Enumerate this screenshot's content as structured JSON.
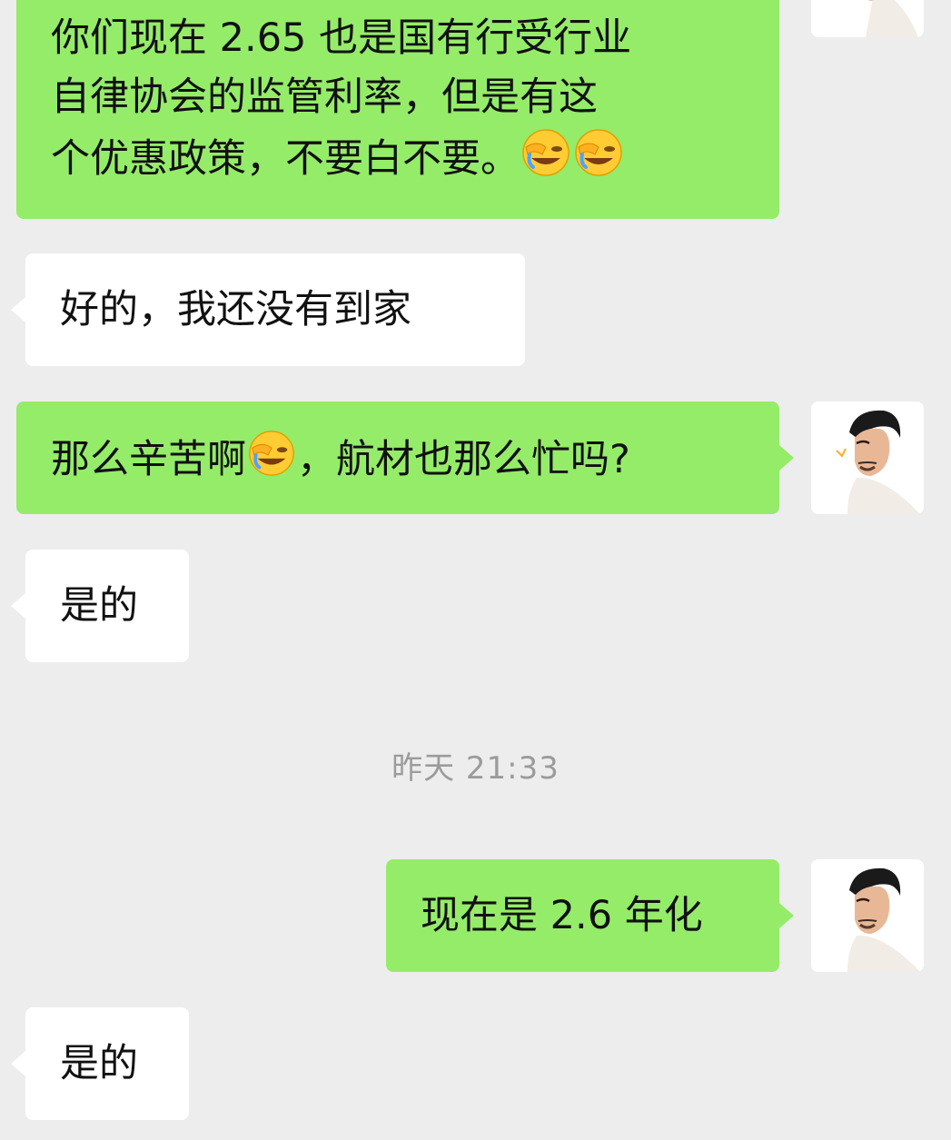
{
  "messages": [
    {
      "direction": "outgoing",
      "lines": [
        "你们现在 2.65 也是国有行受行业",
        "自律协会的监管利率，但是有这",
        "个优惠政策，不要白不要。"
      ],
      "trailing_emojis": [
        "facepalm-laugh-emoji",
        "facepalm-laugh-emoji"
      ]
    },
    {
      "direction": "incoming",
      "text": "好的，我还没有到家"
    },
    {
      "direction": "outgoing",
      "text_before_emoji": "那么辛苦啊",
      "emoji": "facepalm-laugh-emoji",
      "text_after_emoji": "，航材也那么忙吗?"
    },
    {
      "direction": "incoming",
      "text": "是的"
    },
    {
      "direction": "outgoing",
      "text": "现在是 2.6 年化"
    },
    {
      "direction": "incoming",
      "text": "是的"
    }
  ],
  "timestamp": "昨天 21:33",
  "colors": {
    "background": "#ededed",
    "outgoing_bubble": "#95ec69",
    "incoming_bubble": "#ffffff",
    "timestamp_text": "#9b9b9b"
  }
}
